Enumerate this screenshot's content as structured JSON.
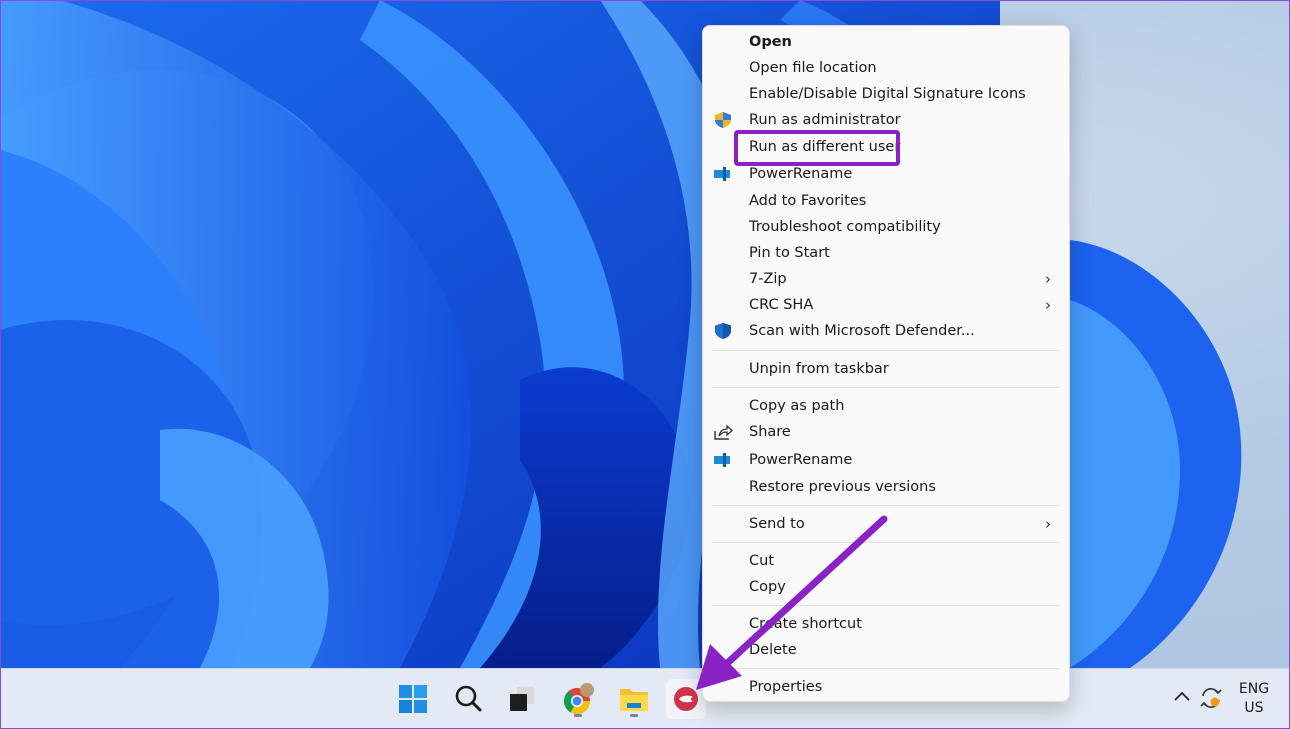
{
  "context_menu": {
    "items": [
      {
        "label": "Open",
        "bold": true,
        "icon": null,
        "submenu": false
      },
      {
        "label": "Open file location",
        "icon": null,
        "submenu": false
      },
      {
        "label": "Enable/Disable Digital Signature Icons",
        "icon": null,
        "submenu": false
      },
      {
        "label": "Run as administrator",
        "icon": "uac-shield-icon",
        "submenu": false
      },
      {
        "label": "Run as different user",
        "icon": null,
        "submenu": false,
        "highlighted": true
      },
      {
        "label": "PowerRename",
        "icon": "powerrename-icon",
        "submenu": false
      },
      {
        "label": "Add to Favorites",
        "icon": null,
        "submenu": false
      },
      {
        "label": "Troubleshoot compatibility",
        "icon": null,
        "submenu": false
      },
      {
        "label": "Pin to Start",
        "icon": null,
        "submenu": false
      },
      {
        "label": "7-Zip",
        "icon": null,
        "submenu": true
      },
      {
        "label": "CRC SHA",
        "icon": null,
        "submenu": true
      },
      {
        "label": "Scan with Microsoft Defender...",
        "icon": "defender-shield-icon",
        "submenu": false
      },
      {
        "label": "Unpin from taskbar",
        "icon": null,
        "submenu": false
      },
      {
        "label": "Copy as path",
        "icon": null,
        "submenu": false
      },
      {
        "label": "Share",
        "icon": "share-icon",
        "submenu": false
      },
      {
        "label": "PowerRename",
        "icon": "powerrename-icon",
        "submenu": false
      },
      {
        "label": "Restore previous versions",
        "icon": null,
        "submenu": false
      },
      {
        "label": "Send to",
        "icon": null,
        "submenu": true
      },
      {
        "label": "Cut",
        "icon": null,
        "submenu": false
      },
      {
        "label": "Copy",
        "icon": null,
        "submenu": false
      },
      {
        "label": "Create shortcut",
        "icon": null,
        "submenu": false
      },
      {
        "label": "Delete",
        "icon": null,
        "submenu": false
      },
      {
        "label": "Properties",
        "icon": null,
        "submenu": false
      }
    ],
    "submenu_glyph": "›"
  },
  "taskbar": {
    "icons": [
      {
        "name": "start-button",
        "icon": "windows-logo-icon"
      },
      {
        "name": "search-button",
        "icon": "search-icon"
      },
      {
        "name": "task-view-button",
        "icon": "task-view-icon"
      },
      {
        "name": "chrome-button",
        "icon": "chrome-icon",
        "running": true
      },
      {
        "name": "file-explorer-button",
        "icon": "folder-icon",
        "running": true
      },
      {
        "name": "app-button",
        "icon": "app-red-icon",
        "active": true
      }
    ],
    "tray": {
      "chevron": "show-hidden-icons",
      "sync_icon": "sync-icon",
      "lang_line1": "ENG",
      "lang_line2": "US"
    }
  },
  "annotation": {
    "highlight_color": "#8a22c6",
    "arrow_color": "#8a22c6"
  }
}
